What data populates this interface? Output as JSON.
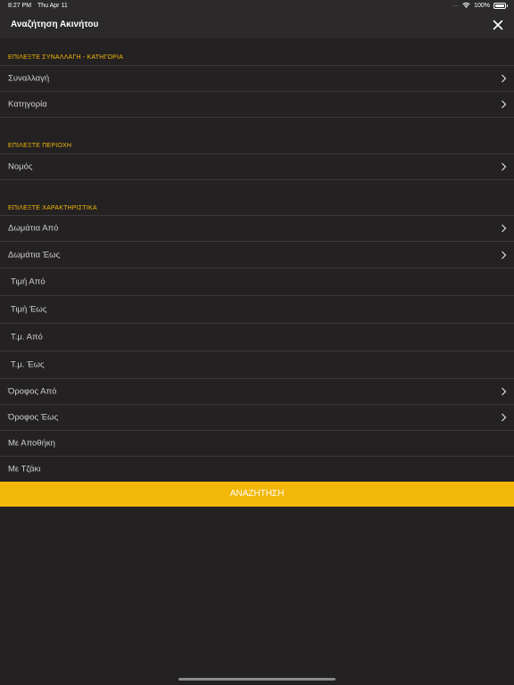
{
  "status_bar": {
    "time": "8:27 PM",
    "date": "Thu Apr 11",
    "signal": "....",
    "battery": "100%"
  },
  "nav": {
    "title": "Αναζήτηση Ακινήτου"
  },
  "sections": {
    "transaction_category": {
      "header": "ΕΠΙΛΕΞΤΕ ΣΥΝΑΛΛΑΓΗ - ΚΑΤΗΓΟΡΙΑ",
      "transaction": "Συναλλαγή",
      "category": "Κατηγορία"
    },
    "area": {
      "header": "ΕΠΙΛΕΞΤΕ ΠΕΡΙΟΧΗ",
      "prefecture": "Νομός"
    },
    "features": {
      "header": "ΕΠΙΛΕΞΤΕ ΧΑΡΑΚΤΗΡΙΣΤΙΚΑ",
      "rooms_from": "Δωμάτια Από",
      "rooms_to": "Δωμάτια Έως",
      "price_from": "Τιμή Από",
      "price_to": "Τιμή Έως",
      "sqm_from": "Τ.μ. Από",
      "sqm_to": "Τ.μ. Έως",
      "floor_from": "Όροφος Από",
      "floor_to": "Όροφος Έως",
      "storage": "Με Αποθήκη",
      "fireplace": "Με Τζάκι"
    }
  },
  "search_button": "ΑΝΑΖΗΤΗΣΗ",
  "colors": {
    "accent": "#f3b809",
    "background": "#242122",
    "bar": "#2b2929"
  }
}
